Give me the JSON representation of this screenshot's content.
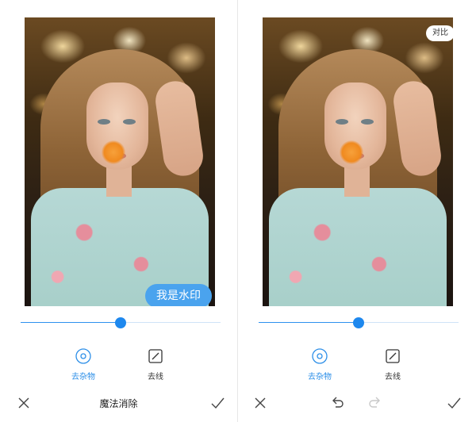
{
  "left_panel": {
    "watermark_text": "我是水印",
    "slider": {
      "value": 0.5
    },
    "tools": [
      {
        "label": "去杂物",
        "icon": "circle-target-icon",
        "active": true
      },
      {
        "label": "去线",
        "icon": "square-slash-icon",
        "active": false
      }
    ],
    "bottom": {
      "title": "魔法消除",
      "cancel_icon": "close-icon",
      "confirm_icon": "check-icon"
    }
  },
  "right_panel": {
    "compare_label": "对比",
    "slider": {
      "value": 0.5
    },
    "tools": [
      {
        "label": "去杂物",
        "icon": "circle-target-icon",
        "active": true
      },
      {
        "label": "去线",
        "icon": "square-slash-icon",
        "active": false
      }
    ],
    "bottom": {
      "cancel_icon": "close-icon",
      "undo_icon": "undo-icon",
      "redo_icon": "redo-icon",
      "confirm_icon": "check-icon"
    }
  },
  "colors": {
    "accent": "#2d8fe8",
    "watermark_bg": "#4aa3ee"
  }
}
